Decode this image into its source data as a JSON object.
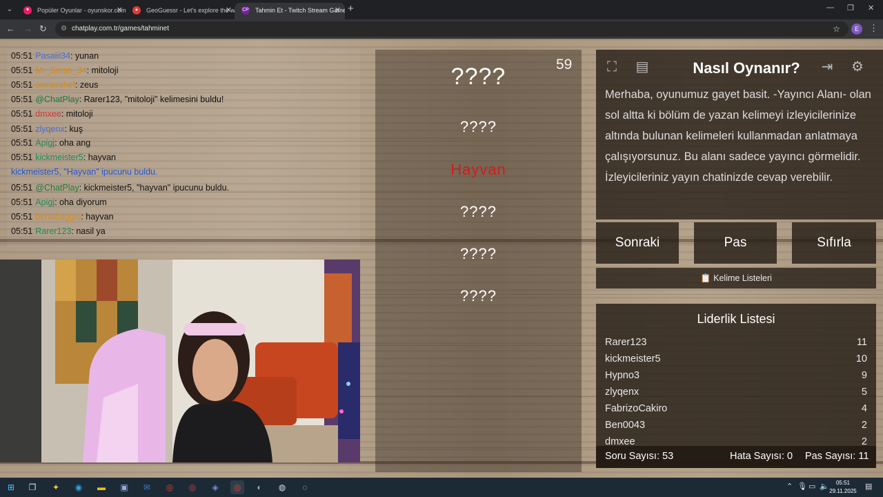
{
  "browser": {
    "tabs": [
      {
        "title": "Popüler Oyunlar - oyunskor.com",
        "fav": "heart-icon",
        "fav_color": "#e91e63"
      },
      {
        "title": "GeoGuessr - Let's explore the world",
        "fav": "map-pin-icon",
        "fav_color": "#e53935"
      },
      {
        "title": "Tahmin Et - Twitch Stream Games",
        "fav": "chatplay-icon",
        "fav_color": "#7b1fa2"
      }
    ],
    "url": "chatplay.com.tr/games/tahminet",
    "profile_initial": "E"
  },
  "chat": {
    "lines": [
      {
        "time": "05:51",
        "user": "Pasaiii34",
        "msg": ": yunan",
        "color": "#4a6fd1"
      },
      {
        "time": "05:51",
        "user": "Mr_Sinan_34",
        "msg": ": mitoloji",
        "color": "#d58b1b"
      },
      {
        "time": "05:51",
        "user": "ownerchef",
        "msg": ": zeus",
        "color": "#d58b1b"
      },
      {
        "time": "05:51",
        "user": "@ChatPlay",
        "msg": ": Rarer123, \"mitoloji\" kelimesini buldu!",
        "color": "#1f7a3a"
      },
      {
        "time": "05:51",
        "user": "dmxee",
        "msg": ": mitoloji",
        "color": "#d33a3a"
      },
      {
        "time": "05:51",
        "user": "zlyqenx",
        "msg": ": kuş",
        "color": "#4a6fd1"
      },
      {
        "time": "05:51",
        "user": "Apigj",
        "msg": ": oha ang",
        "color": "#1f8a55"
      },
      {
        "time": "05:51",
        "user": "kickmeister5",
        "msg": ": hayvan",
        "color": "#1f8a55"
      },
      {
        "time": "",
        "user": "kickmeister5, \"Hayvan\" ipucunu buldu.",
        "msg": "",
        "color": "#2255cc"
      },
      {
        "time": "05:51",
        "user": "@ChatPlay",
        "msg": ": kickmeister5, \"hayvan\" ipucunu buldu.",
        "color": "#1f7a3a"
      },
      {
        "time": "05:51",
        "user": "Apigj",
        "msg": ": oha diyorum",
        "color": "#1f8a55"
      },
      {
        "time": "05:51",
        "user": "beratbaggio",
        "msg": ": hayvan",
        "color": "#d58b1b"
      },
      {
        "time": "05:51",
        "user": "Rarer123",
        "msg": ": nasil ya",
        "color": "#1f8a55"
      }
    ]
  },
  "game": {
    "timer": "59",
    "words": [
      "????",
      "????",
      "Hayvan",
      "????",
      "????",
      "????"
    ],
    "howto_title": "Nasıl Oynanır?",
    "howto_text": "Merhaba, oyunumuz gayet basit. -Yayıncı Alanı- olan sol altta ki bölüm de yazan kelimeyi izleyicilerinize altında bulunan kelimeleri kullanmadan anlatmaya çalışıyorsunuz. Bu alanı sadece yayıncı görmelidir. İzleyicileriniz yayın chatinizde cevap verebilir.",
    "buttons": {
      "next": "Sonraki",
      "pass": "Pas",
      "reset": "Sıfırla"
    },
    "word_lists": "Kelime Listeleri",
    "leaderboard_title": "Liderlik Listesi",
    "leaderboard": [
      {
        "name": "Rarer123",
        "score": "11"
      },
      {
        "name": "kickmeister5",
        "score": "10"
      },
      {
        "name": "Hypno3",
        "score": "9"
      },
      {
        "name": "zlyqenx",
        "score": "5"
      },
      {
        "name": "FabrizoCakiro",
        "score": "4"
      },
      {
        "name": "Ben0043",
        "score": "2"
      },
      {
        "name": "dmxee",
        "score": "2"
      }
    ],
    "footer": {
      "questions": "Soru Sayısı: 53",
      "errors": "Hata Sayısı: 0",
      "passes": "Pas Sayısı: 11"
    }
  },
  "taskbar": {
    "time": "05:51",
    "date": "29.11.2025"
  }
}
